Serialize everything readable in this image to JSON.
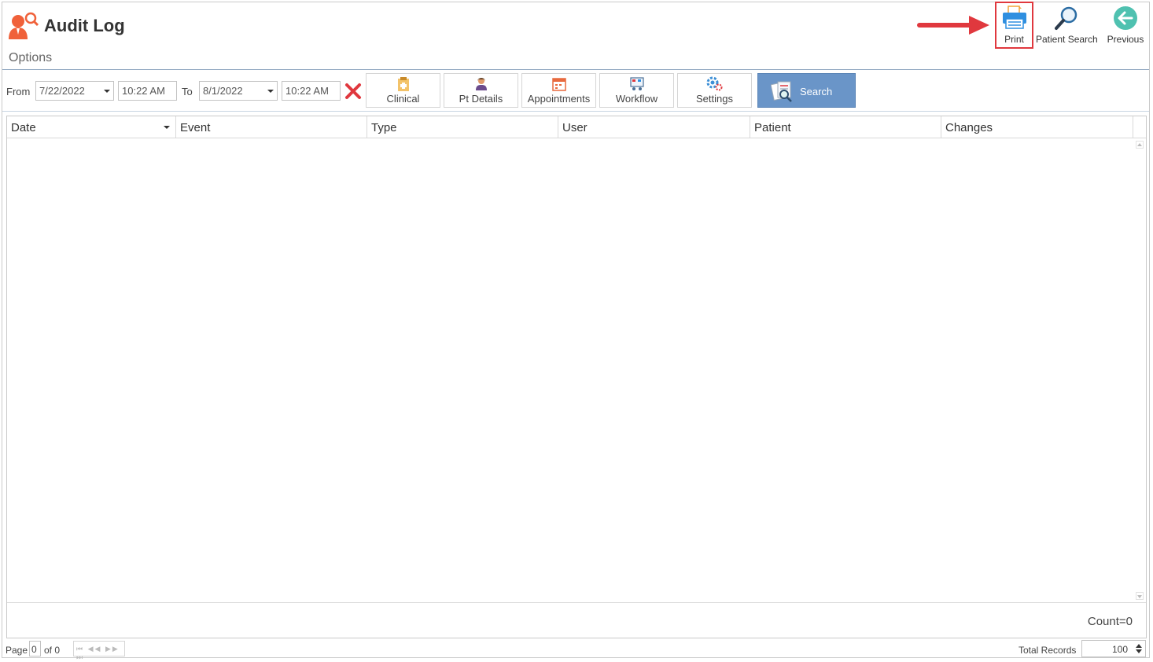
{
  "header": {
    "title": "Audit Log",
    "options_label": "Options"
  },
  "toolbar": {
    "print_label": "Print",
    "patient_search_label": "Patient Search",
    "previous_label": "Previous"
  },
  "filters": {
    "from_label": "From",
    "from_date": "7/22/2022",
    "from_time": "10:22 AM",
    "to_label": "To",
    "to_date": "8/1/2022",
    "to_time": "10:22 AM"
  },
  "categories": [
    {
      "label": "Clinical",
      "icon": "clinical-icon"
    },
    {
      "label": "Pt Details",
      "icon": "patient-details-icon"
    },
    {
      "label": "Appointments",
      "icon": "calendar-icon"
    },
    {
      "label": "Workflow",
      "icon": "workflow-icon"
    },
    {
      "label": "Settings",
      "icon": "gears-icon"
    }
  ],
  "search_button": {
    "label": "Search",
    "icon": "search-documents-icon"
  },
  "grid": {
    "columns": [
      "Date",
      "Event",
      "Type",
      "User",
      "Patient",
      "Changes"
    ],
    "rows": [],
    "count_text": "Count=0"
  },
  "pager": {
    "page_label": "Page",
    "page_value": "0",
    "of_text": "of 0",
    "total_records_label": "Total Records",
    "total_records_value": "100"
  },
  "colors": {
    "accent_red": "#e0383e",
    "search_button_bg": "#6a95c8",
    "logo_orange": "#f0613a"
  }
}
